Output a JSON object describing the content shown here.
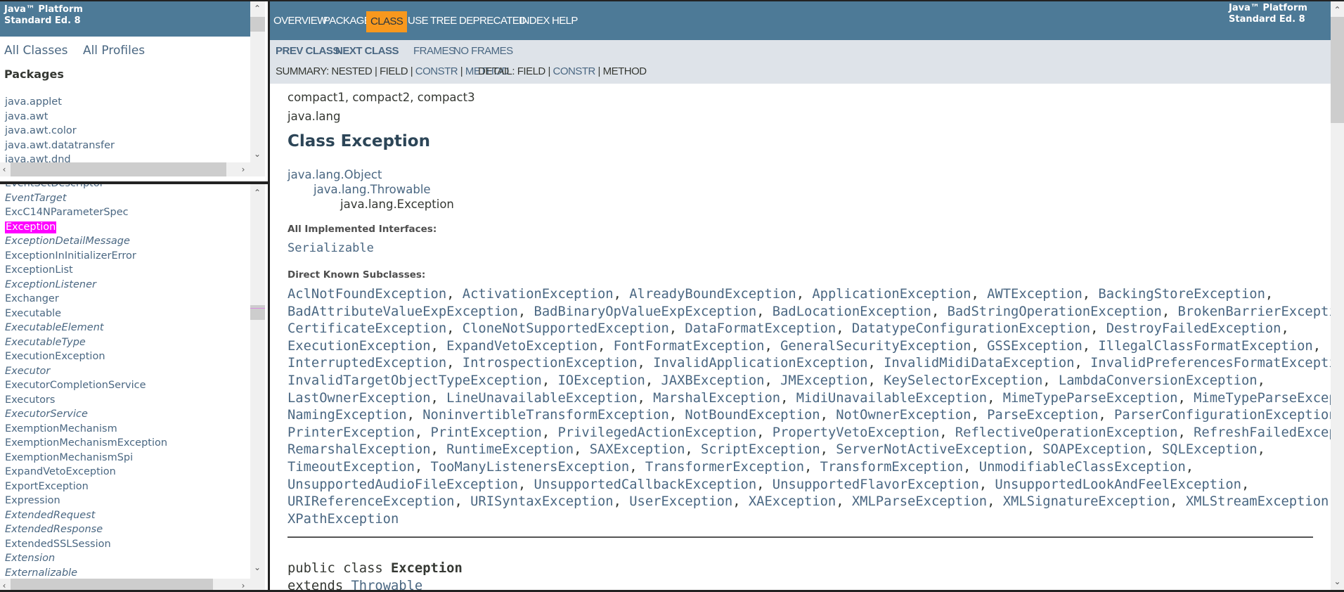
{
  "left_header": {
    "line1": "Java™ Platform",
    "line2": "Standard Ed. 8"
  },
  "left_nav": {
    "all_classes": "All Classes",
    "all_profiles": "All Profiles"
  },
  "packages": {
    "heading": "Packages",
    "items": [
      "java.applet",
      "java.awt",
      "java.awt.color",
      "java.awt.datatransfer",
      "java.awt.dnd"
    ]
  },
  "classes": {
    "selected": "Exception",
    "items": [
      {
        "name": "EventSetDescriptor",
        "italic": false
      },
      {
        "name": "EventTarget",
        "italic": true
      },
      {
        "name": "ExcC14NParameterSpec",
        "italic": false
      },
      {
        "name": "Exception",
        "italic": false
      },
      {
        "name": "ExceptionDetailMessage",
        "italic": true
      },
      {
        "name": "ExceptionInInitializerError",
        "italic": false
      },
      {
        "name": "ExceptionList",
        "italic": false
      },
      {
        "name": "ExceptionListener",
        "italic": true
      },
      {
        "name": "Exchanger",
        "italic": false
      },
      {
        "name": "Executable",
        "italic": false
      },
      {
        "name": "ExecutableElement",
        "italic": true
      },
      {
        "name": "ExecutableType",
        "italic": true
      },
      {
        "name": "ExecutionException",
        "italic": false
      },
      {
        "name": "Executor",
        "italic": true
      },
      {
        "name": "ExecutorCompletionService",
        "italic": false
      },
      {
        "name": "Executors",
        "italic": false
      },
      {
        "name": "ExecutorService",
        "italic": true
      },
      {
        "name": "ExemptionMechanism",
        "italic": false
      },
      {
        "name": "ExemptionMechanismException",
        "italic": false
      },
      {
        "name": "ExemptionMechanismSpi",
        "italic": false
      },
      {
        "name": "ExpandVetoException",
        "italic": false
      },
      {
        "name": "ExportException",
        "italic": false
      },
      {
        "name": "Expression",
        "italic": false
      },
      {
        "name": "ExtendedRequest",
        "italic": true
      },
      {
        "name": "ExtendedResponse",
        "italic": true
      },
      {
        "name": "ExtendedSSLSession",
        "italic": false
      },
      {
        "name": "Extension",
        "italic": true
      },
      {
        "name": "Externalizable",
        "italic": true
      }
    ]
  },
  "top_nav": {
    "active": "CLASS",
    "items": [
      "OVERVIEW",
      "PACKAGE",
      "CLASS",
      "USE",
      "TREE",
      "DEPRECATED",
      "INDEX",
      "HELP"
    ]
  },
  "right_header": {
    "line1": "Java™ Platform",
    "line2": "Standard Ed. 8"
  },
  "sub_nav": {
    "prev_class": "PREV CLASS",
    "next_class": "NEXT CLASS",
    "frames": "FRAMES",
    "no_frames": "NO FRAMES",
    "summary_label": "SUMMARY:",
    "summary_nested": "NESTED",
    "summary_field": "FIELD",
    "summary_constr": "CONSTR",
    "summary_method": "METHOD",
    "detail_label": "DETAIL:",
    "detail_field": "FIELD",
    "detail_constr": "CONSTR",
    "detail_method": "METHOD",
    "sep": "|"
  },
  "content": {
    "profiles": "compact1, compact2, compact3",
    "package": "java.lang",
    "title": "Class Exception",
    "hierarchy": [
      "java.lang.Object",
      "java.lang.Throwable",
      "java.lang.Exception"
    ],
    "interfaces_label": "All Implemented Interfaces:",
    "interfaces": "Serializable",
    "subclasses_label": "Direct Known Subclasses:",
    "subclass_lines": [
      [
        "AclNotFoundException",
        "ActivationException",
        "AlreadyBoundException",
        "ApplicationException",
        "AWTException",
        "BackingStoreException"
      ],
      [
        "BadAttributeValueExpException",
        "BadBinaryOpValueExpException",
        "BadLocationException",
        "BadStringOperationException",
        "BrokenBarrierException"
      ],
      [
        "CertificateException",
        "CloneNotSupportedException",
        "DataFormatException",
        "DatatypeConfigurationException",
        "DestroyFailedException"
      ],
      [
        "ExecutionException",
        "ExpandVetoException",
        "FontFormatException",
        "GeneralSecurityException",
        "GSSException",
        "IllegalClassFormatException"
      ],
      [
        "InterruptedException",
        "IntrospectionException",
        "InvalidApplicationException",
        "InvalidMidiDataException",
        "InvalidPreferencesFormatException"
      ],
      [
        "InvalidTargetObjectTypeException",
        "IOException",
        "JAXBException",
        "JMException",
        "KeySelectorException",
        "LambdaConversionException"
      ],
      [
        "LastOwnerException",
        "LineUnavailableException",
        "MarshalException",
        "MidiUnavailableException",
        "MimeTypeParseException",
        "MimeTypeParseException"
      ],
      [
        "NamingException",
        "NoninvertibleTransformException",
        "NotBoundException",
        "NotOwnerException",
        "ParseException",
        "ParserConfigurationException"
      ],
      [
        "PrinterException",
        "PrintException",
        "PrivilegedActionException",
        "PropertyVetoException",
        "ReflectiveOperationException",
        "RefreshFailedException"
      ],
      [
        "RemarshalException",
        "RuntimeException",
        "SAXException",
        "ScriptException",
        "ServerNotActiveException",
        "SOAPException",
        "SQLException"
      ],
      [
        "TimeoutException",
        "TooManyListenersException",
        "TransformerException",
        "TransformException",
        "UnmodifiableClassException"
      ],
      [
        "UnsupportedAudioFileException",
        "UnsupportedCallbackException",
        "UnsupportedFlavorException",
        "UnsupportedLookAndFeelException"
      ],
      [
        "URIReferenceException",
        "URISyntaxException",
        "UserException",
        "XAException",
        "XMLParseException",
        "XMLSignatureException",
        "XMLStreamException"
      ],
      [
        "XPathException"
      ]
    ],
    "decl_prefix": "public class ",
    "decl_name": "Exception",
    "extends_kw": "extends ",
    "extends_name": "Throwable"
  },
  "colors": {
    "header": "#4d7a97",
    "subnav": "#dee3e9",
    "active_tab": "#f8981d",
    "link": "#4a6782",
    "text": "#353833",
    "selection": "#ff00ff"
  }
}
